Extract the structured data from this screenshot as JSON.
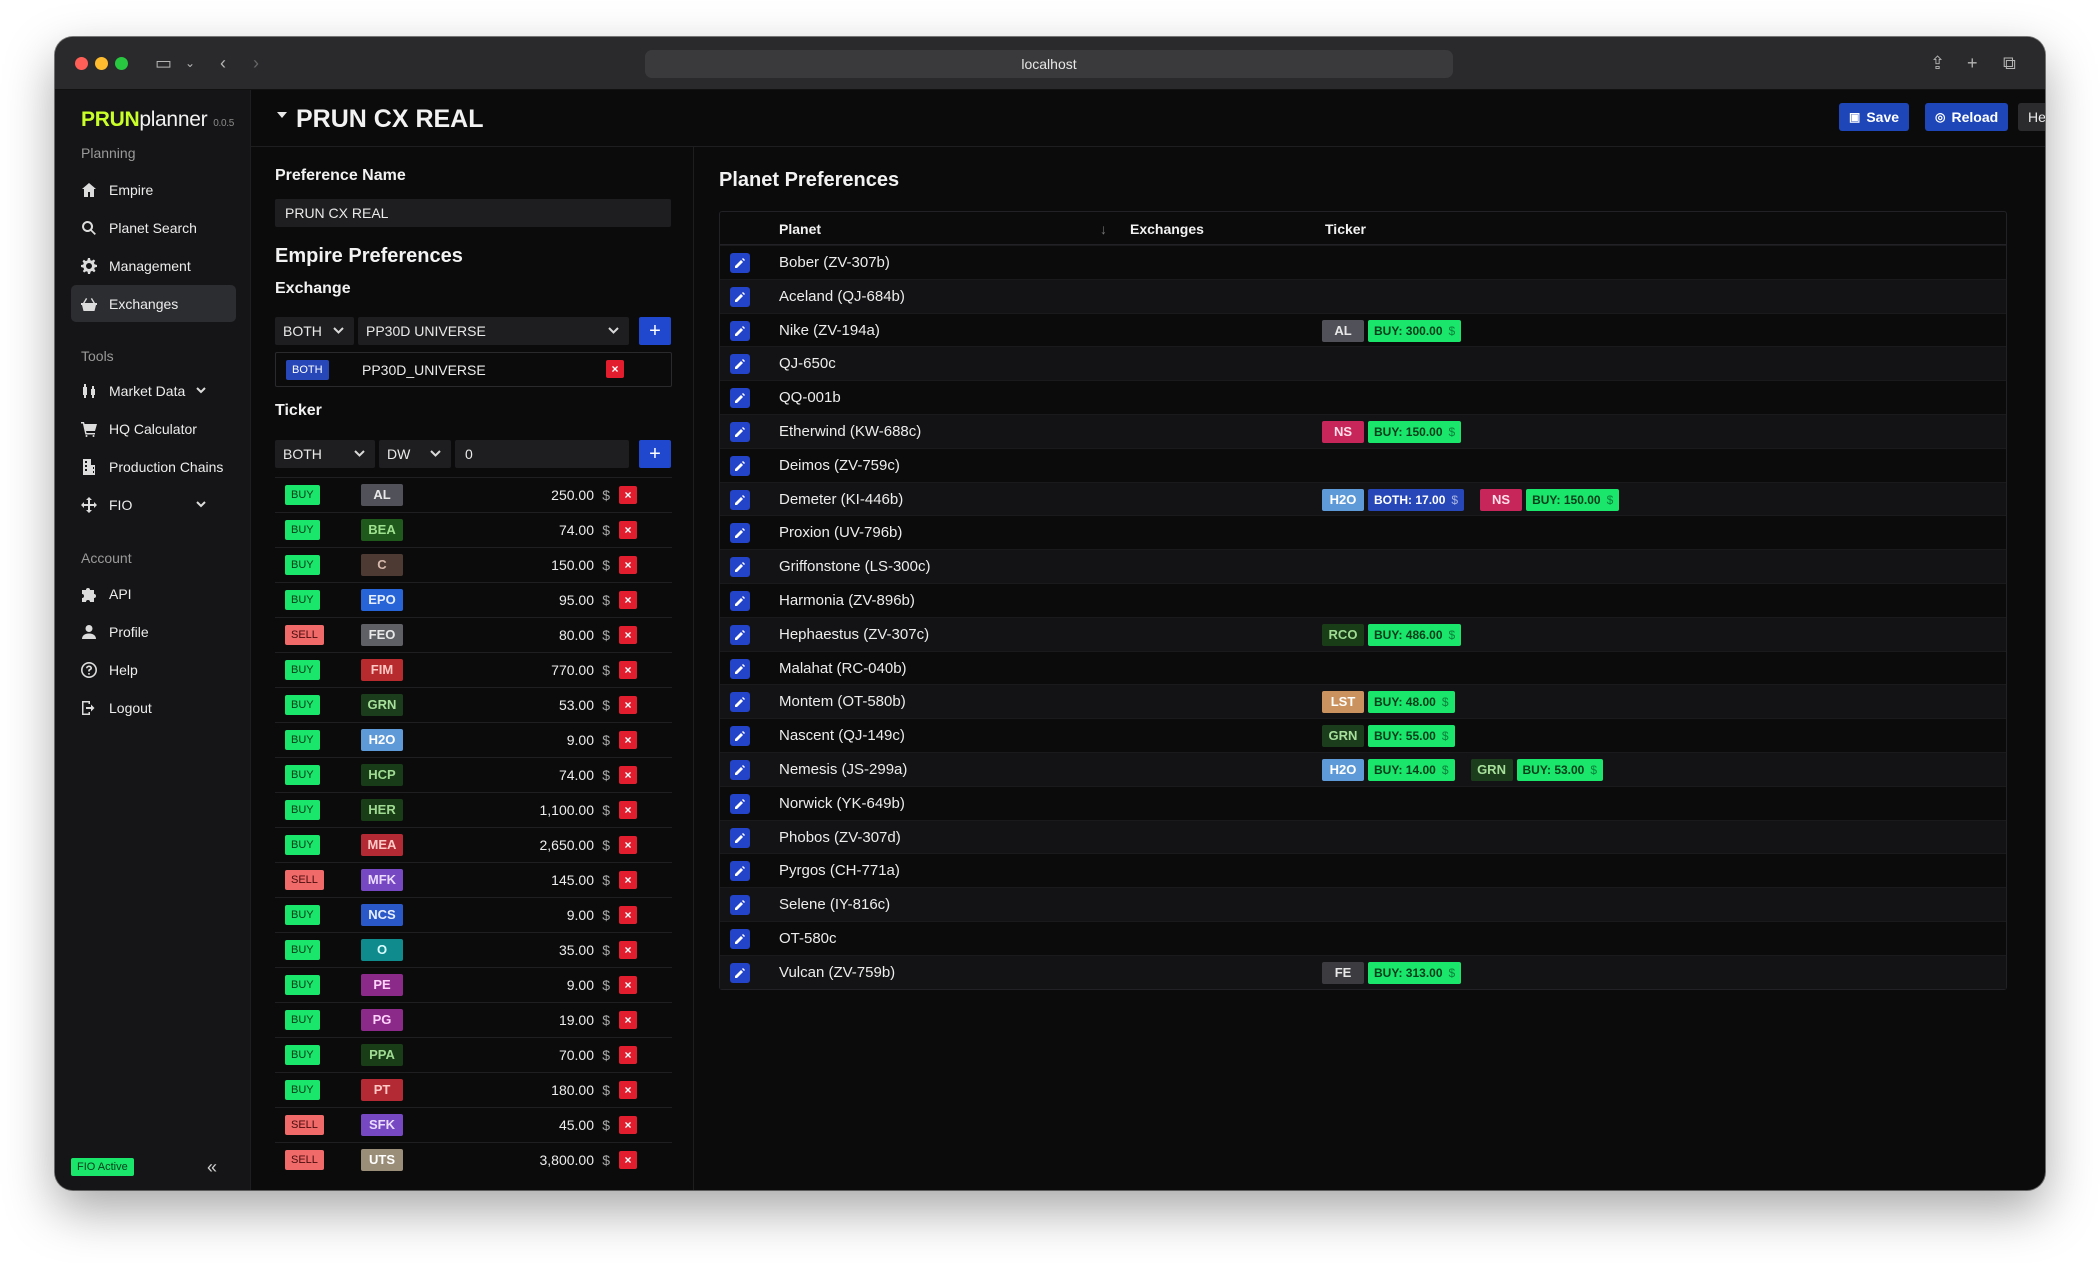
{
  "browser": {
    "url": "localhost"
  },
  "app": {
    "brand_a": "PRUN",
    "brand_b": "planner",
    "version": "0.0.5",
    "sections": {
      "planning": "Planning",
      "tools": "Tools",
      "account": "Account"
    },
    "nav": {
      "empire": "Empire",
      "planet_search": "Planet Search",
      "management": "Management",
      "exchanges": "Exchanges",
      "market_data": "Market Data",
      "hq_calculator": "HQ Calculator",
      "production_chains": "Production Chains",
      "fio": "FIO",
      "api": "API",
      "profile": "Profile",
      "help": "Help",
      "logout": "Logout"
    },
    "fio_badge": "FIO Active",
    "collapse": "«"
  },
  "header": {
    "title": "PRUN CX REAL",
    "save": "Save",
    "reload": "Reload",
    "help": "Help"
  },
  "left": {
    "pref_name_label": "Preference Name",
    "pref_name_value": "PRUN CX REAL",
    "empire_prefs": "Empire Preferences",
    "exchange_label": "Exchange",
    "exchange_type": "BOTH",
    "exchange_universe": "PP30D UNIVERSE",
    "exchange_entry": {
      "tag": "BOTH",
      "name": "PP30D_UNIVERSE"
    },
    "ticker_label": "Ticker",
    "ticker_type": "BOTH",
    "ticker_exchange": "DW",
    "ticker_value": "0",
    "currency": "$",
    "remove": "×",
    "tickers": [
      {
        "type": "BUY",
        "ticker": "AL",
        "value": "250.00",
        "bg": "#515159",
        "fg": "#e8e8e8"
      },
      {
        "type": "BUY",
        "ticker": "BEA",
        "value": "74.00",
        "bg": "#1f5a1c",
        "fg": "#9ee28f"
      },
      {
        "type": "BUY",
        "ticker": "C",
        "value": "150.00",
        "bg": "#4d3a33",
        "fg": "#d6b9ac"
      },
      {
        "type": "BUY",
        "ticker": "EPO",
        "value": "95.00",
        "bg": "#2764d7",
        "fg": "#e6eeff"
      },
      {
        "type": "SELL",
        "ticker": "FEO",
        "value": "80.00",
        "bg": "#5f6066",
        "fg": "#e8e8e8"
      },
      {
        "type": "BUY",
        "ticker": "FIM",
        "value": "770.00",
        "bg": "#b72a2d",
        "fg": "#ffc9c5"
      },
      {
        "type": "BUY",
        "ticker": "GRN",
        "value": "53.00",
        "bg": "#1b3d1c",
        "fg": "#a6e09a"
      },
      {
        "type": "BUY",
        "ticker": "H2O",
        "value": "9.00",
        "bg": "#5f9ad8",
        "fg": "#ffffff"
      },
      {
        "type": "BUY",
        "ticker": "HCP",
        "value": "74.00",
        "bg": "#183c18",
        "fg": "#9fdc92"
      },
      {
        "type": "BUY",
        "ticker": "HER",
        "value": "1,100.00",
        "bg": "#193d17",
        "fg": "#9fdc92"
      },
      {
        "type": "BUY",
        "ticker": "MEA",
        "value": "2,650.00",
        "bg": "#b42a34",
        "fg": "#ffc9c5"
      },
      {
        "type": "SELL",
        "ticker": "MFK",
        "value": "145.00",
        "bg": "#7648c2",
        "fg": "#eadbff"
      },
      {
        "type": "BUY",
        "ticker": "NCS",
        "value": "9.00",
        "bg": "#2b58c9",
        "fg": "#e6eeff"
      },
      {
        "type": "BUY",
        "ticker": "O",
        "value": "35.00",
        "bg": "#0f8a8d",
        "fg": "#d9ffff"
      },
      {
        "type": "BUY",
        "ticker": "PE",
        "value": "9.00",
        "bg": "#8c2a8a",
        "fg": "#ffd2fb"
      },
      {
        "type": "BUY",
        "ticker": "PG",
        "value": "19.00",
        "bg": "#8c2a8a",
        "fg": "#ffd2fb"
      },
      {
        "type": "BUY",
        "ticker": "PPA",
        "value": "70.00",
        "bg": "#193d17",
        "fg": "#9fdc92"
      },
      {
        "type": "BUY",
        "ticker": "PT",
        "value": "180.00",
        "bg": "#b42a34",
        "fg": "#ffc9c5"
      },
      {
        "type": "SELL",
        "ticker": "SFK",
        "value": "45.00",
        "bg": "#7648c2",
        "fg": "#eadbff"
      },
      {
        "type": "SELL",
        "ticker": "UTS",
        "value": "3,800.00",
        "bg": "#9b8e78",
        "fg": "#ffffff"
      }
    ]
  },
  "right": {
    "title": "Planet Preferences",
    "col_planet": "Planet",
    "col_exchanges": "Exchanges",
    "col_ticker": "Ticker",
    "planets": [
      {
        "name": "Bober (ZV-307b)",
        "ticks": []
      },
      {
        "name": "Aceland (QJ-684b)",
        "ticks": []
      },
      {
        "name": "Nike (ZV-194a)",
        "ticks": [
          {
            "t": "AL",
            "bg": "#515159",
            "fg": "#e8e8e8",
            "mode": "BUY",
            "v": "300.00"
          }
        ]
      },
      {
        "name": "QJ-650c",
        "ticks": []
      },
      {
        "name": "QQ-001b",
        "ticks": []
      },
      {
        "name": "Etherwind (KW-688c)",
        "ticks": [
          {
            "t": "NS",
            "bg": "#c7265a",
            "fg": "#ffe0ea",
            "mode": "BUY",
            "v": "150.00"
          }
        ]
      },
      {
        "name": "Deimos (ZV-759c)",
        "ticks": []
      },
      {
        "name": "Demeter (KI-446b)",
        "ticks": [
          {
            "t": "H2O",
            "bg": "#5f9ad8",
            "fg": "#ffffff",
            "mode": "BOTH",
            "v": "17.00"
          },
          {
            "t": "NS",
            "bg": "#c7265a",
            "fg": "#ffe0ea",
            "mode": "BUY",
            "v": "150.00"
          }
        ]
      },
      {
        "name": "Proxion (UV-796b)",
        "ticks": []
      },
      {
        "name": "Griffonstone (LS-300c)",
        "ticks": []
      },
      {
        "name": "Harmonia (ZV-896b)",
        "ticks": []
      },
      {
        "name": "Hephaestus (ZV-307c)",
        "ticks": [
          {
            "t": "RCO",
            "bg": "#193d17",
            "fg": "#9fdc92",
            "mode": "BUY",
            "v": "486.00"
          }
        ]
      },
      {
        "name": "Malahat (RC-040b)",
        "ticks": []
      },
      {
        "name": "Montem (OT-580b)",
        "ticks": [
          {
            "t": "LST",
            "bg": "#c9925e",
            "fg": "#fff",
            "mode": "BUY",
            "v": "48.00"
          }
        ]
      },
      {
        "name": "Nascent (QJ-149c)",
        "ticks": [
          {
            "t": "GRN",
            "bg": "#1b3d1c",
            "fg": "#a6e09a",
            "mode": "BUY",
            "v": "55.00"
          }
        ]
      },
      {
        "name": "Nemesis (JS-299a)",
        "ticks": [
          {
            "t": "H2O",
            "bg": "#5f9ad8",
            "fg": "#ffffff",
            "mode": "BUY",
            "v": "14.00"
          },
          {
            "t": "GRN",
            "bg": "#1b3d1c",
            "fg": "#a6e09a",
            "mode": "BUY",
            "v": "53.00"
          }
        ]
      },
      {
        "name": "Norwick (YK-649b)",
        "ticks": []
      },
      {
        "name": "Phobos (ZV-307d)",
        "ticks": []
      },
      {
        "name": "Pyrgos (CH-771a)",
        "ticks": []
      },
      {
        "name": "Selene (IY-816c)",
        "ticks": []
      },
      {
        "name": "OT-580c",
        "ticks": []
      },
      {
        "name": "Vulcan (ZV-759b)",
        "ticks": [
          {
            "t": "FE",
            "bg": "#3c3c40",
            "fg": "#e8e8e8",
            "mode": "BUY",
            "v": "313.00"
          }
        ]
      }
    ]
  },
  "colors": {
    "buy_bg": "#19e66b",
    "buy_fg": "#063d1a",
    "sell_bg": "#f06a6a",
    "sell_fg": "#4a0b0b",
    "both_bg": "#2747b8",
    "both_fg": "#ffffff",
    "accent": "#1f48cf"
  }
}
